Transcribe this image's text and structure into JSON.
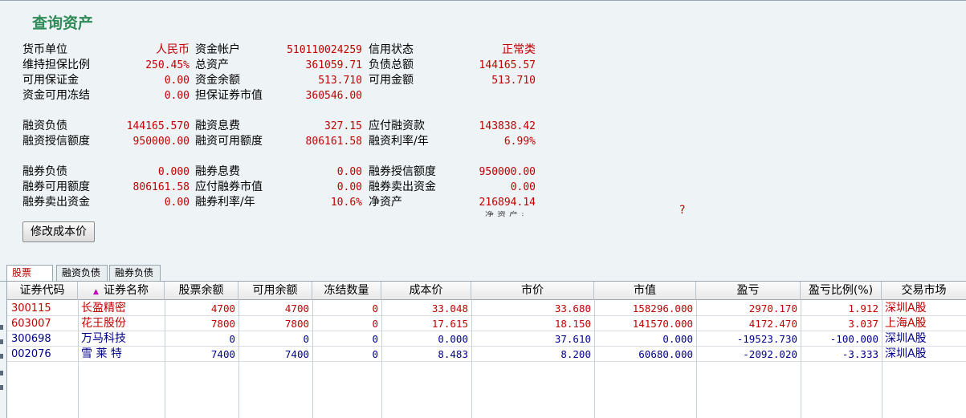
{
  "title": "查询资产",
  "summary": [
    [
      {
        "label": "货币单位",
        "value": "人民币",
        "text": true
      },
      {
        "label": "资金帐户",
        "value": "510110024259"
      },
      {
        "label": "信用状态",
        "value": "正常类",
        "text": true
      }
    ],
    [
      {
        "label": "维持担保比例",
        "value": "250.45%"
      },
      {
        "label": "总资产",
        "value": "361059.71"
      },
      {
        "label": "负债总额",
        "value": "144165.57"
      }
    ],
    [
      {
        "label": "可用保证金",
        "value": "0.00"
      },
      {
        "label": "资金余额",
        "value": "513.710"
      },
      {
        "label": "可用金额",
        "value": "513.710"
      }
    ],
    [
      {
        "label": "资金可用冻结",
        "value": "0.00"
      },
      {
        "label": "担保证券市值",
        "value": "360546.00"
      },
      {
        "label": "",
        "value": ""
      }
    ],
    [
      {
        "label": "融资负债",
        "value": "144165.570"
      },
      {
        "label": "融资息费",
        "value": "327.15"
      },
      {
        "label": "应付融资款",
        "value": "143838.42"
      }
    ],
    [
      {
        "label": "融资授信额度",
        "value": "950000.00"
      },
      {
        "label": "融资可用额度",
        "value": "806161.58"
      },
      {
        "label": "融资利率/年",
        "value": "6.99%"
      }
    ],
    [
      {
        "label": "融券负债",
        "value": "0.000"
      },
      {
        "label": "融券息费",
        "value": "0.00"
      },
      {
        "label": "融券授信额度",
        "value": "950000.00"
      }
    ],
    [
      {
        "label": "融券可用额度",
        "value": "806161.58"
      },
      {
        "label": "应付融券市值",
        "value": "0.00"
      },
      {
        "label": "融券卖出资金",
        "value": "0.00"
      }
    ],
    [
      {
        "label": "融券卖出资金",
        "value": "0.00"
      },
      {
        "label": "融券利率/年",
        "value": "10.6%"
      },
      {
        "label": "净资产",
        "value": "216894.14"
      }
    ]
  ],
  "ghost_text": "净资产:",
  "question_mark": "?",
  "button_label": "修改成本价",
  "tabs": [
    "股票",
    "融资负债",
    "融券负债"
  ],
  "active_tab": 0,
  "sort_icon": "triangle-up-icon",
  "columns": [
    "证券代码",
    "证券名称",
    "股票余额",
    "可用余额",
    "冻结数量",
    "成本价",
    "市价",
    "市值",
    "盈亏",
    "盈亏比例(%)",
    "交易市场"
  ],
  "rows": [
    {
      "code": "300115",
      "name": "长盈精密",
      "balance": "4700",
      "available": "4700",
      "frozen": "0",
      "cost": "33.048",
      "price": "33.680",
      "market_value": "158296.000",
      "pnl": "2970.170",
      "pnl_ratio": "1.912",
      "market": "深圳A股",
      "color": "#c00000"
    },
    {
      "code": "603007",
      "name": "花王股份",
      "balance": "7800",
      "available": "7800",
      "frozen": "0",
      "cost": "17.615",
      "price": "18.150",
      "market_value": "141570.000",
      "pnl": "4172.470",
      "pnl_ratio": "3.037",
      "market": "上海A股",
      "color": "#c00000"
    },
    {
      "code": "300698",
      "name": "万马科技",
      "balance": "0",
      "available": "0",
      "frozen": "0",
      "cost": "0.000",
      "price": "37.610",
      "market_value": "0.000",
      "pnl": "-19523.730",
      "pnl_ratio": "-100.000",
      "market": "深圳A股",
      "color": "#00008b"
    },
    {
      "code": "002076",
      "name": "雪 莱 特",
      "balance": "7400",
      "available": "7400",
      "frozen": "0",
      "cost": "8.483",
      "price": "8.200",
      "market_value": "60680.000",
      "pnl": "-2092.020",
      "pnl_ratio": "-3.333",
      "market": "深圳A股",
      "color": "#00008b"
    }
  ]
}
